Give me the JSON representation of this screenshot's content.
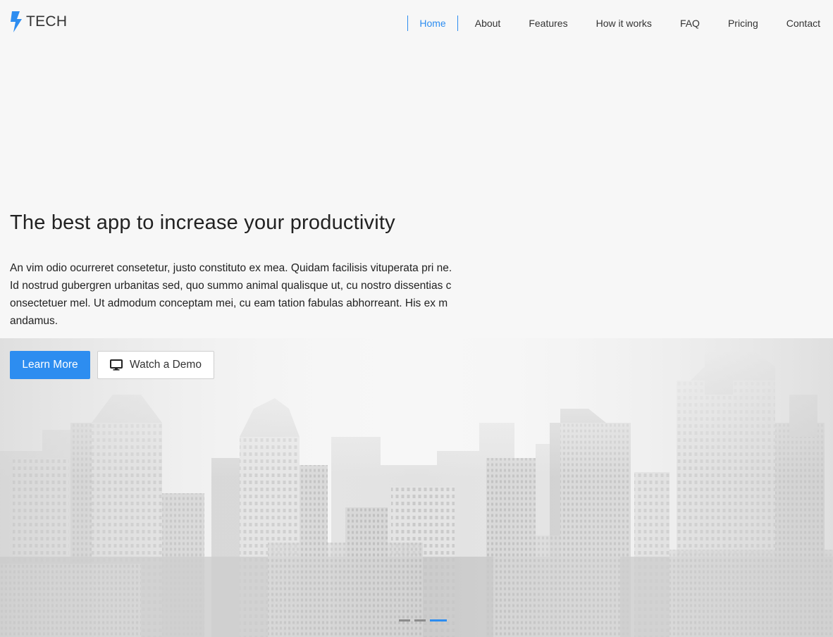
{
  "brand": {
    "name": "TECH",
    "icon": "bolt-icon",
    "accent": "#2d8df0"
  },
  "nav": {
    "items": [
      {
        "label": "Home",
        "active": true
      },
      {
        "label": "About"
      },
      {
        "label": "Features"
      },
      {
        "label": "How it works"
      },
      {
        "label": "FAQ"
      },
      {
        "label": "Pricing"
      },
      {
        "label": "Contact"
      }
    ]
  },
  "hero": {
    "title": "The best app to increase your productivity",
    "text": "An vim odio ocurreret consetetur, justo constituto ex mea. Quidam facilisis vituperata pri ne. Id nostrud gubergren urbanitas sed, quo summo animal qualisque ut, cu nostro dissentias consectetuer mel. Ut admodum conceptam mei, cu eam tation fabulas abhorreant. His ex mandamus.",
    "primary_button": "Learn More",
    "demo_button": {
      "label": "Watch a Demo",
      "icon": "monitor-icon"
    }
  },
  "slider": {
    "slide_count": 3,
    "active_index": 2
  },
  "colors": {
    "accent": "#2d8df0",
    "background": "#f7f7f7",
    "text": "#222222"
  }
}
